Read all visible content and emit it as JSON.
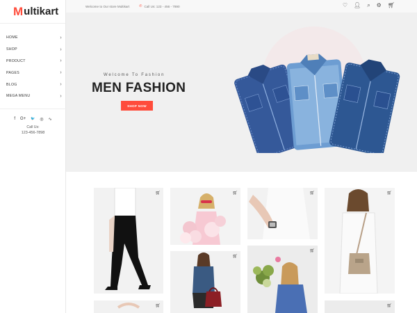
{
  "brand": {
    "logo_initial": "M",
    "logo_rest": "ultikart"
  },
  "sidebar": {
    "items": [
      {
        "label": "HOME"
      },
      {
        "label": "SHOP"
      },
      {
        "label": "PRODUCT"
      },
      {
        "label": "PAGES"
      },
      {
        "label": "BLOG"
      },
      {
        "label": "MEGA MENU"
      }
    ],
    "chevron": "›",
    "socials": [
      {
        "icon": "facebook-icon",
        "glyph": "f"
      },
      {
        "icon": "google-plus-icon",
        "glyph": "G+"
      },
      {
        "icon": "twitter-icon",
        "glyph": "🐦"
      },
      {
        "icon": "instagram-icon",
        "glyph": "◎"
      },
      {
        "icon": "rss-icon",
        "glyph": "∿"
      }
    ],
    "call_label": "Call Us:",
    "call_number": "123-456-7898"
  },
  "topbar": {
    "welcome": "Welcome to Our store Multikart",
    "call": "Call Us: 123 - 456 - 7890",
    "icons": [
      "heart-icon",
      "user-icon",
      "search-icon",
      "settings-icon",
      "cart-icon"
    ]
  },
  "hero": {
    "welcome": "Welcome To Fashion",
    "title": "MEN FASHION",
    "button": "SHOP NOW"
  },
  "colors": {
    "accent": "#ff4c3b",
    "denim_dark": "#2f4f8a",
    "denim_light": "#6f9fd1"
  }
}
